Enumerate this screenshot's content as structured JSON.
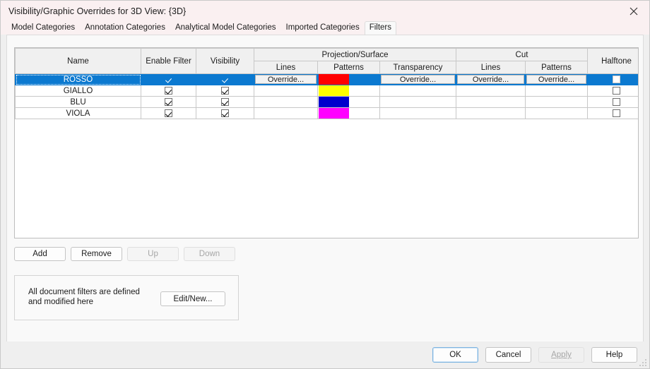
{
  "window": {
    "title": "Visibility/Graphic Overrides for 3D View: {3D}",
    "close_icon": "close-icon"
  },
  "tabs": [
    {
      "label": "Model Categories",
      "active": false
    },
    {
      "label": "Annotation Categories",
      "active": false
    },
    {
      "label": "Analytical Model Categories",
      "active": false
    },
    {
      "label": "Imported Categories",
      "active": false
    },
    {
      "label": "Filters",
      "active": true
    }
  ],
  "table": {
    "group_headers": {
      "name": "Name",
      "enable_filter": "Enable Filter",
      "visibility": "Visibility",
      "projection_surface": "Projection/Surface",
      "cut": "Cut",
      "halftone": "Halftone"
    },
    "sub_headers": {
      "proj_lines": "Lines",
      "proj_patterns": "Patterns",
      "proj_transparency": "Transparency",
      "cut_lines": "Lines",
      "cut_patterns": "Patterns"
    },
    "override_label": "Override...",
    "rows": [
      {
        "name": "ROSSO",
        "selected": true,
        "enable_filter": true,
        "visibility": true,
        "proj_lines": "Override...",
        "proj_pattern_color": "#ff0000",
        "proj_transparency": "Override...",
        "cut_lines": "Override...",
        "cut_patterns": "Override...",
        "halftone": false
      },
      {
        "name": "GIALLO",
        "selected": false,
        "enable_filter": true,
        "visibility": true,
        "proj_lines": "",
        "proj_pattern_color": "#ffff00",
        "proj_transparency": "",
        "cut_lines": "",
        "cut_patterns": "",
        "halftone": false
      },
      {
        "name": "BLU",
        "selected": false,
        "enable_filter": true,
        "visibility": true,
        "proj_lines": "",
        "proj_pattern_color": "#0000cc",
        "proj_transparency": "",
        "cut_lines": "",
        "cut_patterns": "",
        "halftone": false
      },
      {
        "name": "VIOLA",
        "selected": false,
        "enable_filter": true,
        "visibility": true,
        "proj_lines": "",
        "proj_pattern_color": "#ff00ff",
        "proj_transparency": "",
        "cut_lines": "",
        "cut_patterns": "",
        "halftone": false
      }
    ]
  },
  "actions": {
    "add": "Add",
    "remove": "Remove",
    "up": "Up",
    "down": "Down",
    "up_disabled": true,
    "down_disabled": true
  },
  "info": {
    "text": "All document filters are defined and modified here",
    "edit_new": "Edit/New..."
  },
  "footer": {
    "ok": "OK",
    "cancel": "Cancel",
    "apply": "Apply",
    "apply_disabled": true,
    "help": "Help"
  },
  "colors": {
    "selection": "#0b79d0",
    "titlebar": "#faf0f1",
    "panel": "#f9f9f9",
    "footer": "#efefef"
  }
}
